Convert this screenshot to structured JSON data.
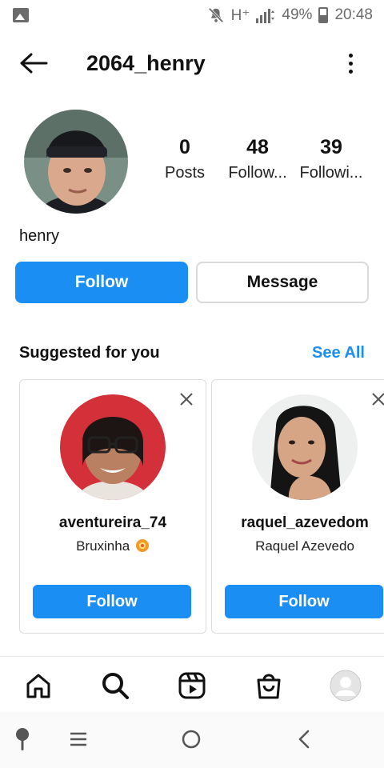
{
  "status_bar": {
    "network": "H⁺",
    "battery_text": "49%",
    "battery_level": 0.49,
    "time": "20:48",
    "icons": [
      "gallery-icon",
      "mute-icon",
      "signal-icon",
      "battery-icon"
    ]
  },
  "header": {
    "title": "2064_henry",
    "back_icon": "arrow-left-icon",
    "more_icon": "more-vertical-icon"
  },
  "profile": {
    "display_name": "henry",
    "stats": [
      {
        "value": "0",
        "label": "Posts"
      },
      {
        "value": "48",
        "label": "Follow..."
      },
      {
        "value": "39",
        "label": "Followi..."
      }
    ],
    "follow_label": "Follow",
    "message_label": "Message"
  },
  "suggested": {
    "title": "Suggested for you",
    "see_all": "See All",
    "cards": [
      {
        "username": "aventureira_74",
        "subtitle": "Bruxinha",
        "follow_label": "Follow"
      },
      {
        "username": "raquel_azevedom",
        "subtitle": "Raquel Azevedo",
        "follow_label": "Follow"
      }
    ]
  },
  "bottom_nav": [
    "home-icon",
    "search-icon",
    "reels-icon",
    "shop-icon",
    "profile-avatar"
  ],
  "system_nav": [
    "assistant-icon",
    "recents-icon",
    "home-circle-icon",
    "back-chevron-icon"
  ],
  "colors": {
    "accent": "#1a8ef3",
    "text": "#111111",
    "secondary": "#6b6b6b"
  }
}
